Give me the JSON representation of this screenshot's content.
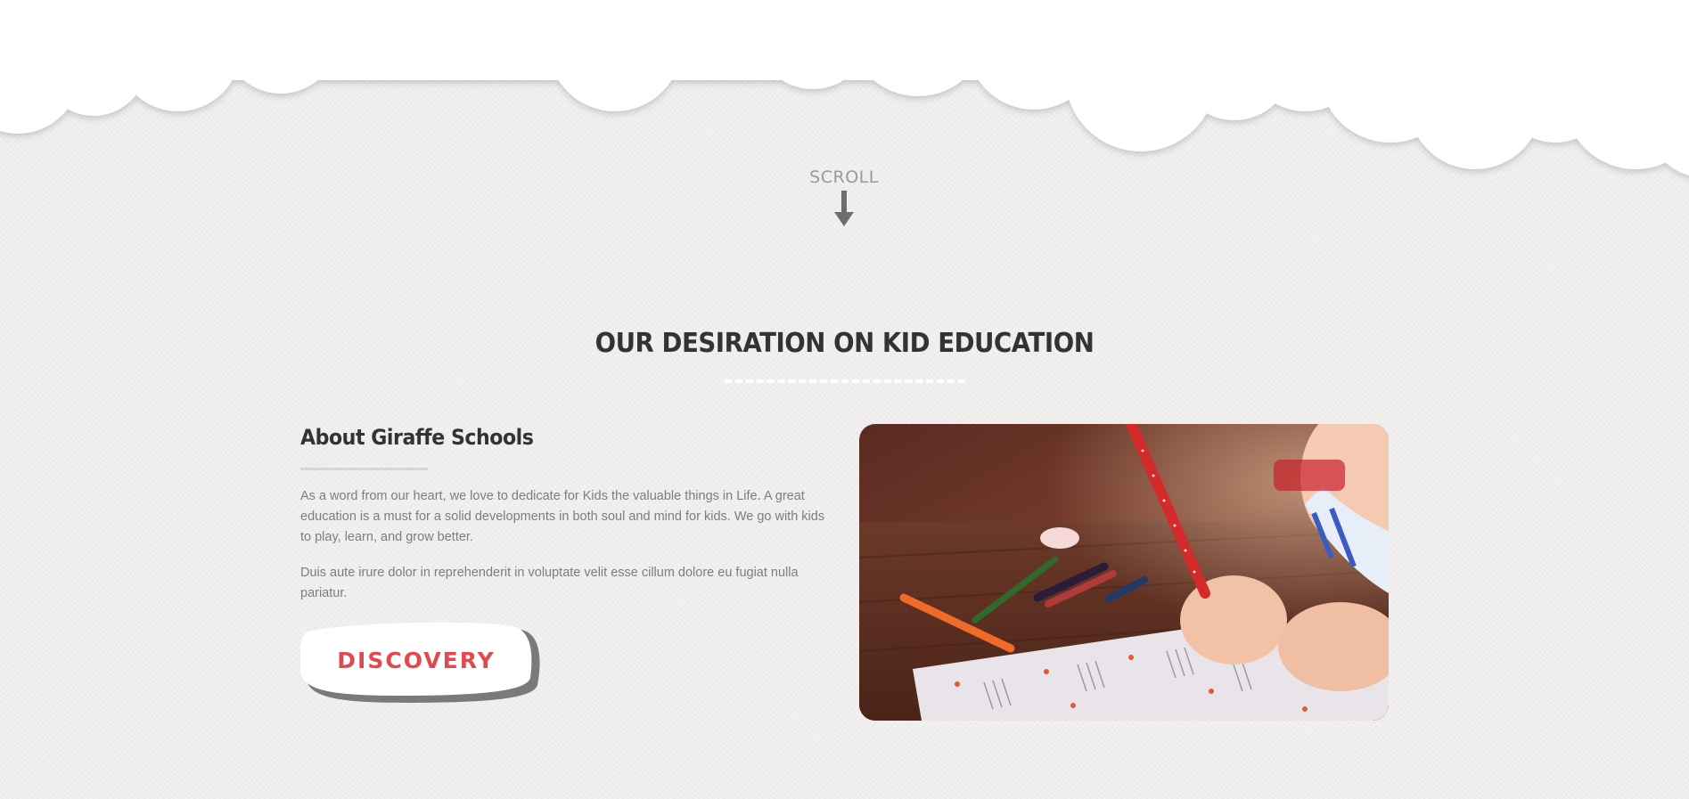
{
  "scroll": {
    "label": "SCROLL"
  },
  "section": {
    "title": "OUR DESIRATION ON KID EDUCATION"
  },
  "about": {
    "heading": "About Giraffe Schools",
    "paragraph1": "As a word from our heart, we love to dedicate for Kids the valuable things in Life. A great education is a must for a solid developments in both soul and mind for kids. We go with kids to play, learn, and grow better.",
    "paragraph2": "Duis aute irure dolor in reprehenderit in voluptate velit esse cillum dolore eu fugiat nulla pariatur.",
    "button_label": "DISCOVERY"
  },
  "colors": {
    "background": "#efeeec",
    "cloud": "#ffffff",
    "heading_text": "#333333",
    "body_text": "#7d7d7d",
    "button_text": "#e04a4f",
    "button_shadow": "#7a7a7a"
  },
  "icons": {
    "scroll": "arrow-down-icon"
  }
}
